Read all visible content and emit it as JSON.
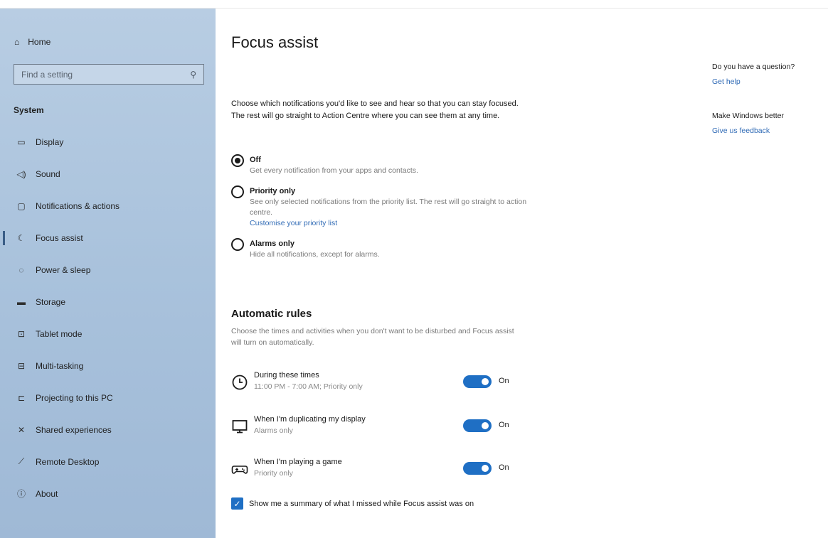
{
  "sidebar": {
    "home_label": "Home",
    "search_placeholder": "Find a setting",
    "section_label": "System",
    "items": [
      {
        "label": "Display",
        "icon": "display-icon"
      },
      {
        "label": "Sound",
        "icon": "sound-icon"
      },
      {
        "label": "Notifications & actions",
        "icon": "notifications-icon"
      },
      {
        "label": "Focus assist",
        "icon": "focus-assist-icon",
        "active": true
      },
      {
        "label": "Power & sleep",
        "icon": "power-icon"
      },
      {
        "label": "Storage",
        "icon": "storage-icon"
      },
      {
        "label": "Tablet mode",
        "icon": "tablet-icon"
      },
      {
        "label": "Multi-tasking",
        "icon": "multitasking-icon"
      },
      {
        "label": "Projecting to this PC",
        "icon": "projecting-icon"
      },
      {
        "label": "Shared experiences",
        "icon": "shared-icon"
      },
      {
        "label": "Remote Desktop",
        "icon": "remote-desktop-icon"
      },
      {
        "label": "About",
        "icon": "info-icon"
      }
    ]
  },
  "main": {
    "title": "Focus assist",
    "intro": "Choose which notifications you'd like to see and hear so that you can stay focused. The rest will go straight to Action Centre where you can see them at any time.",
    "options": [
      {
        "label": "Off",
        "desc": "Get every notification from your apps and contacts.",
        "selected": true
      },
      {
        "label": "Priority only",
        "desc": "See only selected notifications from the priority list. The rest will go straight to action centre.",
        "link": "Customise your priority list",
        "selected": false
      },
      {
        "label": "Alarms only",
        "desc": "Hide all notifications, except for alarms.",
        "selected": false
      }
    ],
    "rules_title": "Automatic rules",
    "rules_desc": "Choose the times and activities when you don't want to be disturbed and Focus assist will turn on automatically.",
    "rules": [
      {
        "title": "During these times",
        "subtitle": "11:00 PM - 7:00 AM; Priority only",
        "state": "On",
        "icon": "clock-icon"
      },
      {
        "title": "When I'm duplicating my display",
        "subtitle": "Alarms only",
        "state": "On",
        "icon": "monitor-icon"
      },
      {
        "title": "When I'm playing a game",
        "subtitle": "Priority only",
        "state": "On",
        "icon": "gamepad-icon"
      }
    ],
    "summary_checkbox": {
      "label": "Show me a summary of what I missed while Focus assist was on",
      "checked": true
    }
  },
  "side_panel": {
    "question_head": "Do you have a question?",
    "question_link": "Get help",
    "feedback_head": "Make Windows better",
    "feedback_link": "Give us feedback"
  },
  "colors": {
    "sidebar_bg": "#a9c2dc",
    "accent": "#1f6fc4",
    "link": "#2f6ab5"
  }
}
